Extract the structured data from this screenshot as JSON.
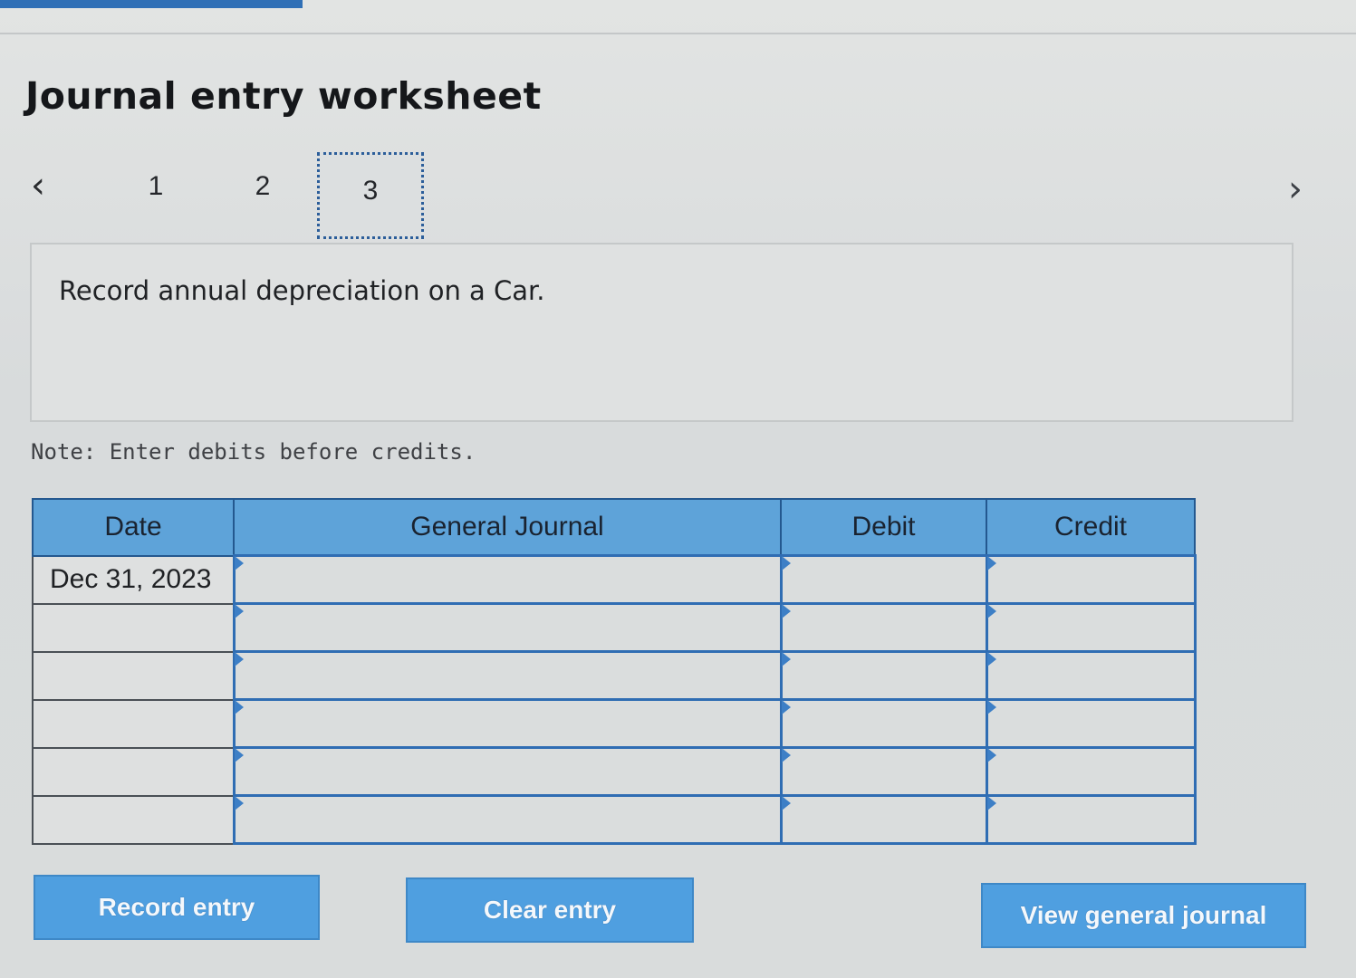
{
  "header": {
    "title": "Journal entry worksheet"
  },
  "nav": {
    "prev_icon": "chevron-left-icon",
    "next_icon": "chevron-right-icon",
    "pages": [
      "1",
      "2",
      "3"
    ],
    "active_page": "3"
  },
  "description": {
    "text": "Record annual depreciation on a Car."
  },
  "note": {
    "text": "Note: Enter debits before credits."
  },
  "journal": {
    "columns": [
      "Date",
      "General Journal",
      "Debit",
      "Credit"
    ],
    "rows": [
      {
        "date": "Dec 31, 2023",
        "account": "",
        "debit": "",
        "credit": ""
      },
      {
        "date": "",
        "account": "",
        "debit": "",
        "credit": ""
      },
      {
        "date": "",
        "account": "",
        "debit": "",
        "credit": ""
      },
      {
        "date": "",
        "account": "",
        "debit": "",
        "credit": ""
      },
      {
        "date": "",
        "account": "",
        "debit": "",
        "credit": ""
      },
      {
        "date": "",
        "account": "",
        "debit": "",
        "credit": ""
      }
    ]
  },
  "buttons": {
    "record_label": "Record entry",
    "clear_label": "Clear entry",
    "view_label": "View general journal"
  },
  "colors": {
    "accent": "#2f6fb6",
    "header_fill": "#5ea3d9",
    "button_fill": "#4f9fe0",
    "entry_border": "#2f6db3"
  }
}
